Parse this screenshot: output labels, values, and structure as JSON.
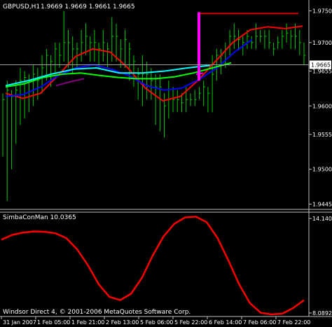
{
  "chart_data": [
    {
      "type": "bar",
      "title": "GBPUSD,H1  1.9669 1.9669 1.9661 1.9665",
      "symbol_header": "GBPUSD,H1",
      "ohlc_readout": "1.9669 1.9669 1.9661 1.9665",
      "current_price": "1.9665",
      "ylim": [
        1.944,
        1.9765
      ],
      "y_ticks": [
        "1.9750",
        "1.9700",
        "1.9655",
        "1.9600",
        "1.9555",
        "1.9500",
        "1.9445"
      ],
      "bars": [
        [
          1.962,
          1.961,
          1.952
        ],
        [
          1.964,
          1.9625,
          1.945
        ],
        [
          1.9625,
          1.9615,
          1.95
        ],
        [
          1.964,
          1.9625,
          1.954
        ],
        [
          1.966,
          1.964,
          1.957
        ],
        [
          1.9655,
          1.9645,
          1.958
        ],
        [
          1.965,
          1.964,
          1.959
        ],
        [
          1.9665,
          1.965,
          1.96
        ],
        [
          1.966,
          1.964,
          1.961
        ],
        [
          1.968,
          1.966,
          1.962
        ],
        [
          1.969,
          1.968,
          1.964
        ],
        [
          1.968,
          1.967,
          1.963
        ],
        [
          1.97,
          1.969,
          1.965
        ],
        [
          1.97,
          1.968,
          1.966
        ],
        [
          1.975,
          1.97,
          1.967
        ],
        [
          1.972,
          1.97,
          1.966
        ],
        [
          1.971,
          1.969,
          1.965
        ],
        [
          1.97,
          1.969,
          1.966
        ],
        [
          1.972,
          1.97,
          1.967
        ],
        [
          1.973,
          1.971,
          1.968
        ],
        [
          1.971,
          1.97,
          1.967
        ],
        [
          1.972,
          1.97,
          1.967
        ],
        [
          1.97,
          1.969,
          1.966
        ],
        [
          1.972,
          1.97,
          1.967
        ],
        [
          1.97,
          1.969,
          1.966
        ],
        [
          1.974,
          1.971,
          1.967
        ],
        [
          1.973,
          1.971,
          1.967
        ],
        [
          1.9705,
          1.969,
          1.966
        ],
        [
          1.972,
          1.9705,
          1.966
        ],
        [
          1.97,
          1.969,
          1.964
        ],
        [
          1.968,
          1.967,
          1.963
        ],
        [
          1.966,
          1.965,
          1.961
        ],
        [
          1.968,
          1.965,
          1.96
        ],
        [
          1.967,
          1.965,
          1.961
        ],
        [
          1.966,
          1.964,
          1.961
        ],
        [
          1.965,
          1.963,
          1.957
        ],
        [
          1.965,
          1.963,
          1.956
        ],
        [
          1.962,
          1.96,
          1.955
        ],
        [
          1.964,
          1.961,
          1.958
        ],
        [
          1.963,
          1.961,
          1.959
        ],
        [
          1.9625,
          1.961,
          1.959
        ],
        [
          1.962,
          1.9605,
          1.959
        ],
        [
          1.963,
          1.961,
          1.959
        ],
        [
          1.962,
          1.961,
          1.96
        ],
        [
          1.9625,
          1.961,
          1.96
        ],
        [
          1.963,
          1.962,
          1.961
        ],
        [
          1.964,
          1.963,
          1.96
        ],
        [
          1.963,
          1.962,
          1.959
        ],
        [
          1.968,
          1.965,
          1.959
        ],
        [
          1.969,
          1.968,
          1.964
        ],
        [
          1.969,
          1.968,
          1.965
        ],
        [
          1.97,
          1.969,
          1.966
        ],
        [
          1.972,
          1.971,
          1.968
        ],
        [
          1.973,
          1.971,
          1.969
        ],
        [
          1.972,
          1.9705,
          1.969
        ],
        [
          1.971,
          1.97,
          1.968
        ],
        [
          1.972,
          1.971,
          1.969
        ],
        [
          1.971,
          1.97,
          1.969
        ],
        [
          1.973,
          1.971,
          1.969
        ],
        [
          1.972,
          1.971,
          1.97
        ],
        [
          1.972,
          1.971,
          1.969
        ],
        [
          1.972,
          1.97,
          1.969
        ],
        [
          1.97,
          1.969,
          1.968
        ],
        [
          1.971,
          1.97,
          1.969
        ],
        [
          1.972,
          1.971,
          1.969
        ],
        [
          1.973,
          1.9715,
          1.97
        ],
        [
          1.972,
          1.971,
          1.969
        ],
        [
          1.973,
          1.971,
          1.969
        ],
        [
          1.972,
          1.97,
          1.968
        ],
        [
          1.97,
          1.968,
          1.9665
        ]
      ],
      "moving_averages": [
        {
          "color": "#ff0000",
          "values": [
            1.962,
            1.9612,
            1.962,
            1.9648,
            1.9678,
            1.969,
            1.9685,
            1.966,
            1.9628,
            1.9608,
            1.9615,
            1.964,
            1.967,
            1.97,
            1.972,
            1.9725,
            1.9722,
            1.9726
          ]
        },
        {
          "color": "#0000ff",
          "values": [
            1.9615,
            1.9618,
            1.963,
            1.9648,
            1.966,
            1.9665,
            1.9658,
            1.9648,
            1.9632,
            1.9625,
            1.9628,
            1.9642,
            1.966,
            1.9685,
            1.9705
          ]
        },
        {
          "color": "#00ff00",
          "values": [
            1.963,
            1.9635,
            1.9645,
            1.965,
            1.9652,
            1.9648,
            1.9645,
            1.9643,
            1.9643,
            1.9646,
            1.9652,
            1.966,
            1.9668
          ]
        },
        {
          "color": "#00ffff",
          "values": [
            1.9632,
            1.964,
            1.965,
            1.9658,
            1.966,
            1.9652,
            1.9652,
            1.9655,
            1.966,
            1.9664
          ]
        },
        {
          "color": "#800080",
          "values": [
            1.9632,
            1.9638,
            1.9643
          ]
        },
        {
          "color": "#ff00ff",
          "values": [
            1.965,
            1.9652
          ]
        }
      ],
      "stop_line_color": "#ff00ff",
      "level_line_color": "#cc0000"
    },
    {
      "type": "line",
      "title": "SimbaConMan 10.0365",
      "y_ticks": [
        "14.1403",
        "8.0892"
      ],
      "ylim": [
        8.0,
        14.3
      ],
      "series": [
        {
          "color": "#ff0000",
          "values": [
            12.7,
            13.0,
            13.15,
            13.22,
            13.2,
            13.1,
            12.8,
            12.1,
            11.1,
            9.9,
            9.1,
            8.9,
            9.3,
            10.3,
            11.7,
            12.9,
            13.7,
            14.1,
            14.15,
            13.8,
            12.8,
            11.4,
            9.9,
            8.7,
            8.1,
            8.0,
            8.05,
            8.4,
            8.9
          ]
        }
      ]
    }
  ],
  "x_ticks": [
    "31 Jan 2007",
    "1 Feb 05:00",
    "1 Feb 21:00",
    "2 Feb 13:00",
    "5 Feb 06:00",
    "5 Feb 22:00",
    "6 Feb 14:00",
    "7 Feb 06:00",
    "7 Feb 22:00"
  ],
  "copyright_text": "Windsor Direct 4, © 2001-2006 MetaQuotes Software Corp.",
  "colors": {
    "bars": "#00cc00",
    "axis": "#c0c0c0",
    "text": "#ffffff",
    "price_label_bg": "#ffffff",
    "price_label_text": "#000000"
  }
}
